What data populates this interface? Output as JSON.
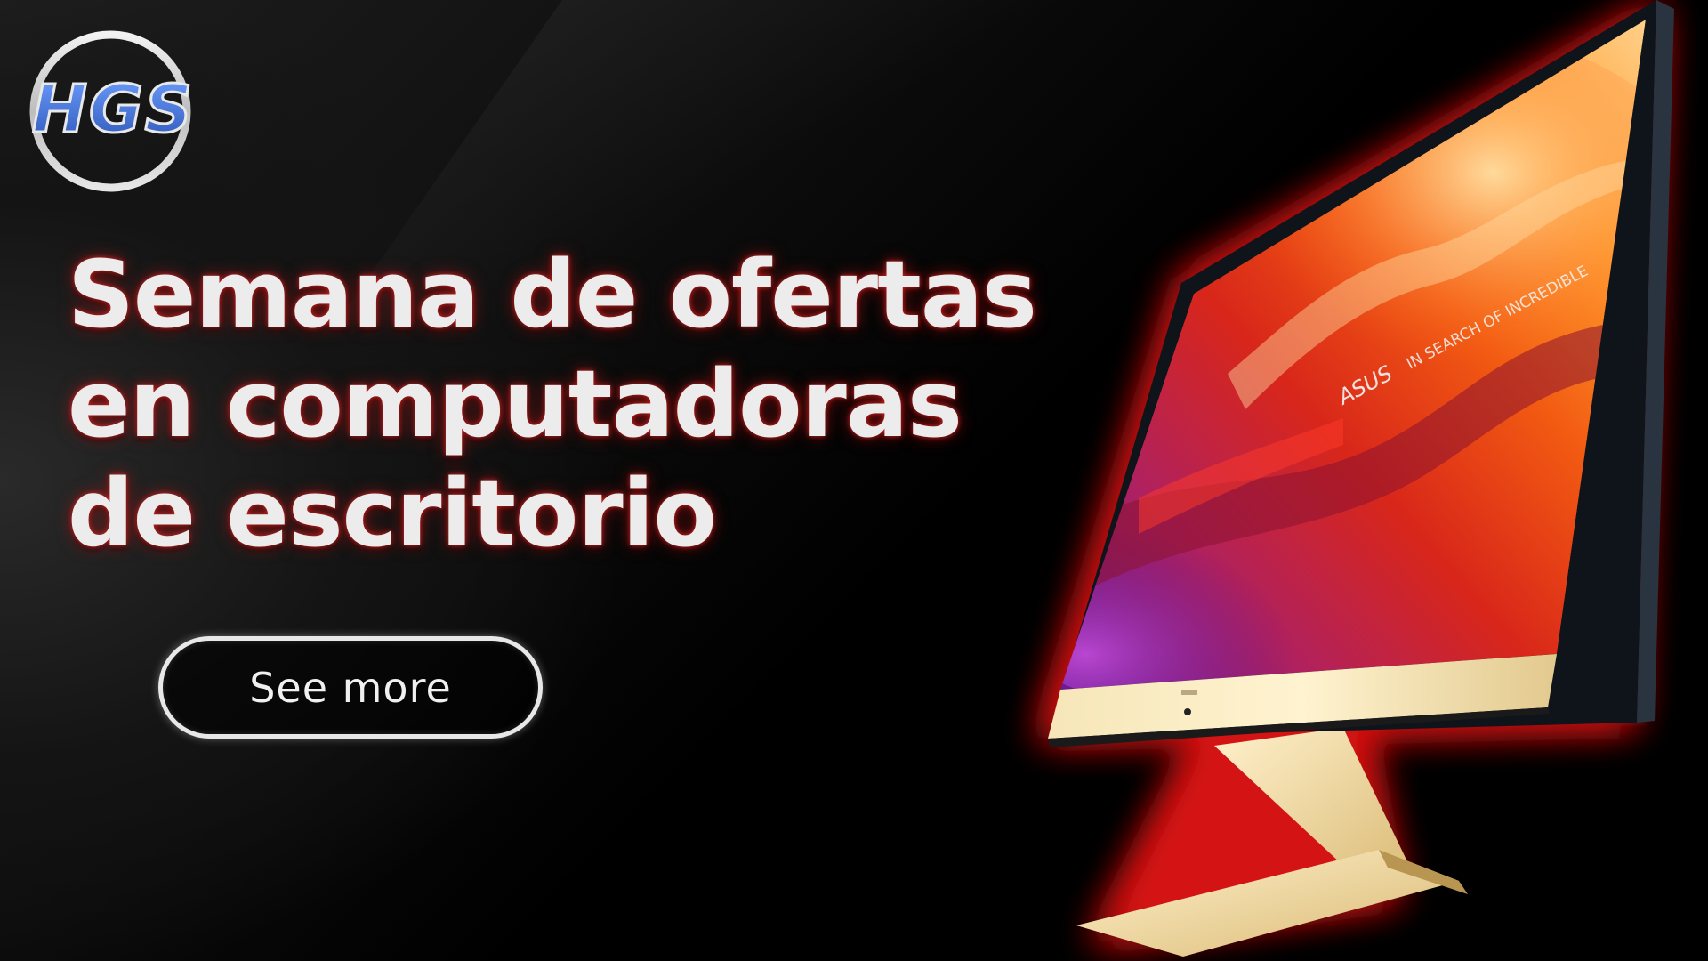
{
  "brand": {
    "logo_text": "HGS"
  },
  "headline": {
    "line1": "Semana de ofertas",
    "line2": "en computadoras",
    "line3": "de escritorio"
  },
  "cta": {
    "label": "See more"
  },
  "product": {
    "screen_brand": "ASUS",
    "screen_tagline": "IN SEARCH OF INCREDIBLE"
  },
  "colors": {
    "glow": "#e02020",
    "text": "#ececec",
    "logo_blue": "#3b6fd4"
  }
}
